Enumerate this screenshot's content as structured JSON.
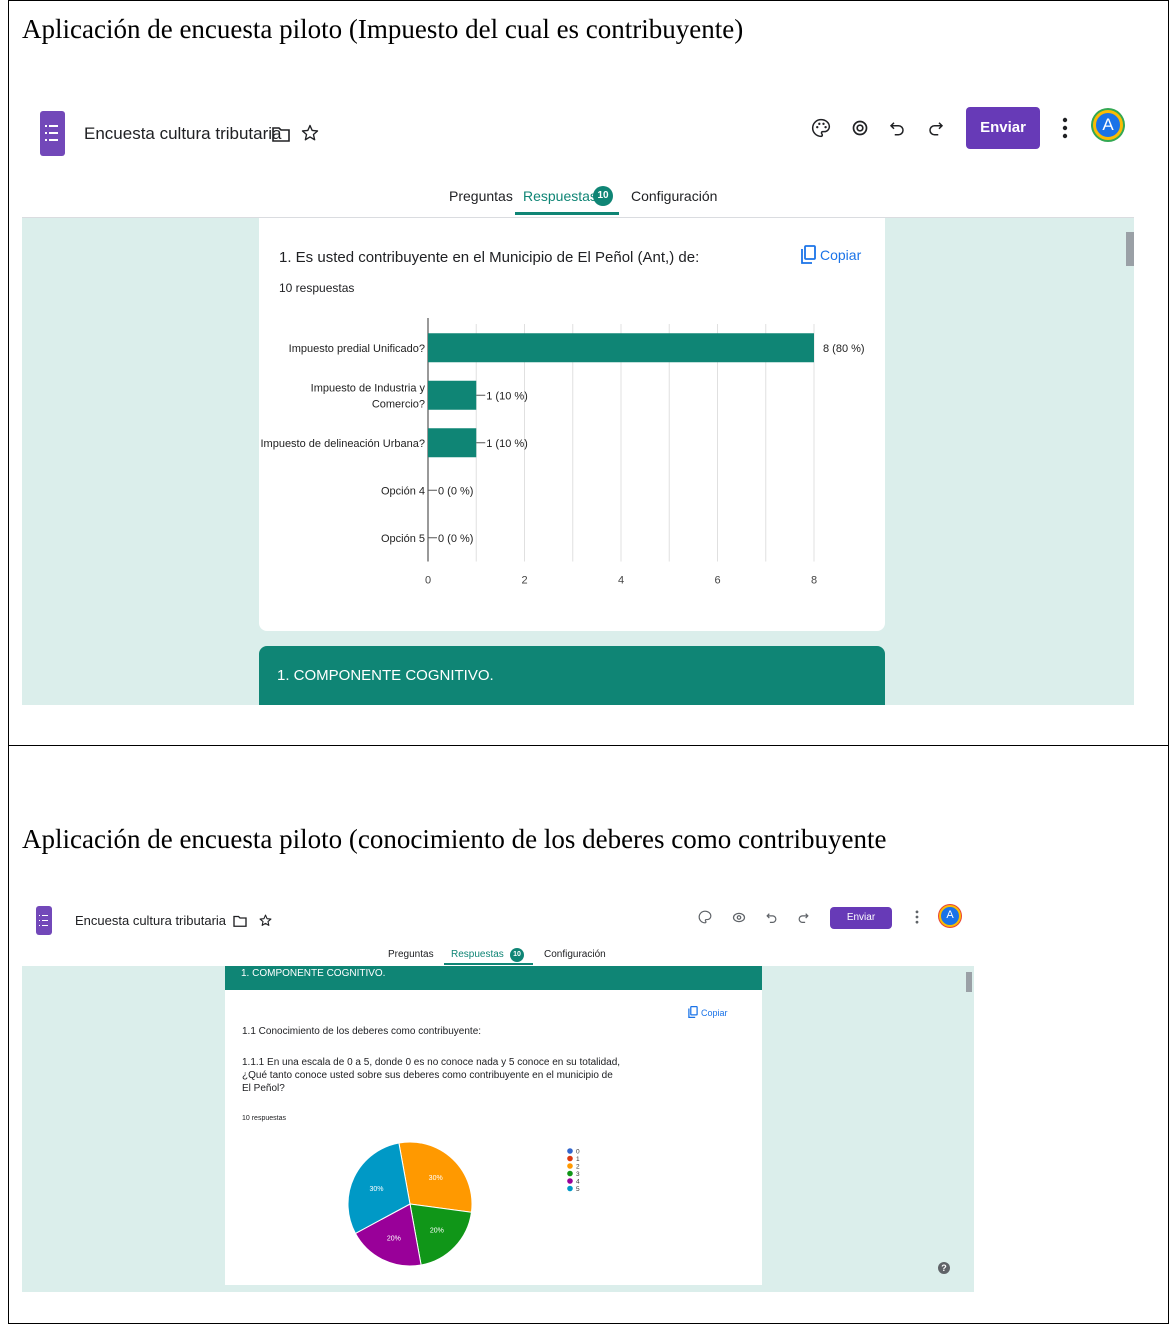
{
  "captions": {
    "first": "Aplicación de encuesta piloto (Impuesto del cual es  contribuyente)",
    "second": "Aplicación de encuesta piloto (conocimiento de los  deberes  como contribuyente"
  },
  "colors": {
    "accent": "#0f8575",
    "brand": "#673ab7",
    "background": "#dbeeeb",
    "link": "#1a73e8"
  },
  "app": {
    "doc_title": "Encuesta cultura tributaria",
    "send_label": "Enviar",
    "avatar_initial": "A",
    "tabs": {
      "questions": "Preguntas",
      "responses": "Respuestas",
      "settings": "Configuración"
    },
    "responses_badge": "10",
    "copy_label": "Copiar",
    "header_icons": [
      "folder-icon",
      "star-icon",
      "palette-icon",
      "preview-eye-icon",
      "undo-icon",
      "redo-icon",
      "more-vert-icon"
    ]
  },
  "screen1": {
    "question_title": "1. Es usted  contribuyente  en  el Municipio  de  El Peñol (Ant,)  de:",
    "responses_count": "10 respuestas",
    "section_title": "1. COMPONENTE COGNITIVO."
  },
  "screen2": {
    "section_title": "1. COMPONENTE COGNITIVO.",
    "subsection": "1.1 Conocimiento de los deberes como contribuyente:",
    "question_lines": [
      "1.1.1 En una escala de 0 a 5, donde 0 es no conoce nada y 5 conoce en su totalidad,",
      "¿Qué tanto conoce usted sobre sus deberes como contribuyente en el municipio de",
      "El Peñol?"
    ],
    "responses_count": "10 respuestas",
    "help_glyph": "?"
  },
  "chart_data": [
    {
      "type": "bar",
      "orientation": "horizontal",
      "categories": [
        "Impuesto predial Unificado?",
        "Impuesto de Industria y Comercio?",
        "Impuesto de delineación Urbana?",
        "Opción 4",
        "Opción 5"
      ],
      "category_lines": [
        [
          "Impuesto predial Unificado?"
        ],
        [
          "Impuesto de Industria y",
          "Comercio?"
        ],
        [
          "Impuesto de delineación Urbana?"
        ],
        [
          "Opción 4"
        ],
        [
          "Opción 5"
        ]
      ],
      "values": [
        8,
        1,
        1,
        0,
        0
      ],
      "data_labels": [
        "8 (80 %)",
        "1 (10 %)",
        "1 (10 %)",
        "0 (0 %)",
        "0 (0 %)"
      ],
      "x_ticks": [
        0,
        2,
        4,
        6,
        8
      ],
      "xlim": [
        0,
        8
      ],
      "grid": true,
      "color": "#0f8575"
    },
    {
      "type": "pie",
      "labels": [
        "0",
        "1",
        "2",
        "3",
        "4",
        "5"
      ],
      "values": [
        0,
        0,
        30,
        20,
        20,
        30
      ],
      "slice_labels": [
        "",
        "",
        "30%",
        "20%",
        "20%",
        "30%"
      ],
      "colors": [
        "#3366cc",
        "#dc3912",
        "#ff9900",
        "#109618",
        "#990099",
        "#0099c6"
      ],
      "legend_position": "right"
    }
  ]
}
